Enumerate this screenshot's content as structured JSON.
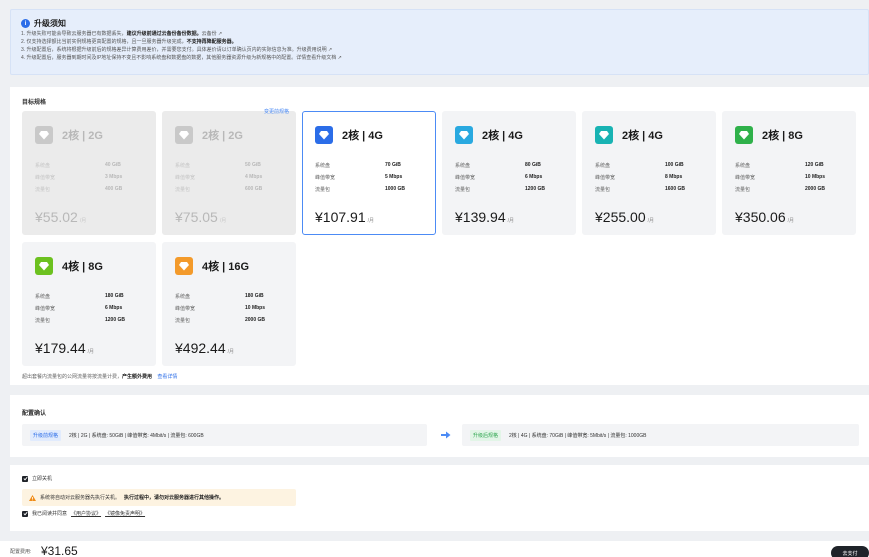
{
  "notice": {
    "title": "升级须知",
    "lines": [
      {
        "text": "1. 升级失败可能会导致云服务器已有数据丢失，",
        "bold": "建议升级前通过云备份备份数据。",
        "tail": "云备份"
      },
      {
        "text": "2. 仅支持选择额比当前实例规格更高配置的规格，且一旦服务器升级完成，",
        "bold": "不支持再降配服务器。",
        "tail": ""
      },
      {
        "text": "3. 升级配置后，系统将根据升级前后的规格差异计算费用差价，并需要您支付。具体差价请以订单确认页内的实际信息为准。",
        "bold": "",
        "tail": "升级费用说明"
      },
      {
        "text": "4. 升级配置后，服务器到期时间及IP地址保持不变且不影响系统盘和数据盘的数据，其他服务器资源升级为新规格中的配置。详情查看升级文档",
        "bold": "",
        "tail": ""
      }
    ],
    "ext_icon": "external-link-icon"
  },
  "target_spec": {
    "title": "目标规格",
    "changed_tag": "变更前规格",
    "plans": [
      {
        "name": "2核 | 2G",
        "specs": [
          {
            "k": "系统盘",
            "v": "40 GiB"
          },
          {
            "k": "峰值带宽",
            "v": "3 Mbps"
          },
          {
            "k": "流量包",
            "v": "400 GB"
          }
        ],
        "price": "¥55.02",
        "unit": "/月",
        "state": "disabled",
        "color": "#c9c9c9"
      },
      {
        "name": "2核 | 2G",
        "specs": [
          {
            "k": "系统盘",
            "v": "50 GiB"
          },
          {
            "k": "峰值带宽",
            "v": "4 Mbps"
          },
          {
            "k": "流量包",
            "v": "600 GB"
          }
        ],
        "price": "¥75.05",
        "unit": "/月",
        "state": "disabled",
        "color": "#c9c9c9"
      },
      {
        "name": "2核 | 4G",
        "specs": [
          {
            "k": "系统盘",
            "v": "70 GiB"
          },
          {
            "k": "峰值带宽",
            "v": "5 Mbps"
          },
          {
            "k": "流量包",
            "v": "1000 GB"
          }
        ],
        "price": "¥107.91",
        "unit": "/月",
        "state": "selected",
        "color": "#2b6de8"
      },
      {
        "name": "2核 | 4G",
        "specs": [
          {
            "k": "系统盘",
            "v": "80 GiB"
          },
          {
            "k": "峰值带宽",
            "v": "6 Mbps"
          },
          {
            "k": "流量包",
            "v": "1200 GB"
          }
        ],
        "price": "¥139.94",
        "unit": "/月",
        "state": "normal",
        "color": "#29a9e0"
      },
      {
        "name": "2核 | 4G",
        "specs": [
          {
            "k": "系统盘",
            "v": "100 GiB"
          },
          {
            "k": "峰值带宽",
            "v": "8 Mbps"
          },
          {
            "k": "流量包",
            "v": "1600 GB"
          }
        ],
        "price": "¥255.00",
        "unit": "/月",
        "state": "normal",
        "color": "#18b3b3"
      },
      {
        "name": "2核 | 8G",
        "specs": [
          {
            "k": "系统盘",
            "v": "120 GiB"
          },
          {
            "k": "峰值带宽",
            "v": "10 Mbps"
          },
          {
            "k": "流量包",
            "v": "2000 GB"
          }
        ],
        "price": "¥350.06",
        "unit": "/月",
        "state": "normal",
        "color": "#2fb14a"
      },
      {
        "name": "4核 | 8G",
        "specs": [
          {
            "k": "系统盘",
            "v": "180 GiB"
          },
          {
            "k": "峰值带宽",
            "v": "6 Mbps"
          },
          {
            "k": "流量包",
            "v": "1200 GB"
          }
        ],
        "price": "¥179.44",
        "unit": "/月",
        "state": "normal",
        "color": "#6cc11f"
      },
      {
        "name": "4核 | 16G",
        "specs": [
          {
            "k": "系统盘",
            "v": "180 GiB"
          },
          {
            "k": "峰值带宽",
            "v": "10 Mbps"
          },
          {
            "k": "流量包",
            "v": "2000 GB"
          }
        ],
        "price": "¥492.44",
        "unit": "/月",
        "state": "normal",
        "color": "#f39a2b"
      }
    ],
    "note_text": "超出套餐内流量包的公网流量将按流量计费，",
    "note_bold": "产生额外费用",
    "note_link": "查看详情"
  },
  "config_confirm": {
    "title": "配置确认",
    "before_tag": "升级前规格",
    "before_text": "2核 | 2G | 系统盘: 50GiB | 峰值带宽: 4Mbit/s | 流量包: 600GB",
    "after_tag": "升级后规格",
    "after_text": "2核 | 4G | 系统盘: 70GiB | 峰值带宽: 5Mbit/s | 流量包: 1000GB"
  },
  "options": {
    "shutdown_label": "立即关机",
    "warn_text": "系统将自动对云服务器先执行关机。",
    "warn_bold": "执行过程中，请勿对云服务器进行其他操作。",
    "agree_prefix": "我已阅读并同意",
    "agree_link1": "《用户协议》",
    "agree_link2": "《镜像免责声明》"
  },
  "footer": {
    "fee_label": "配置费用:",
    "fee_value": "¥31.65",
    "pay_label": "去支付"
  }
}
